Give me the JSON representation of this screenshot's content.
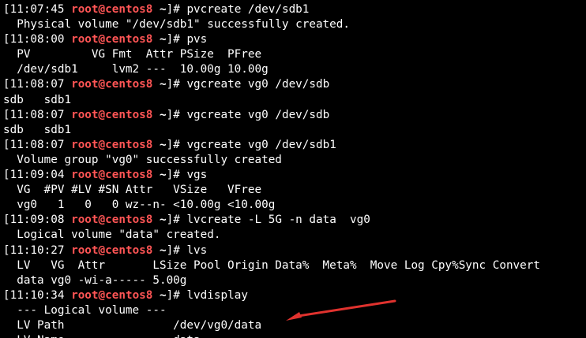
{
  "prompt": {
    "open": "[",
    "at": "@",
    "user": "root",
    "host": "centos8",
    "cwd": "~",
    "close": "]# "
  },
  "colors": {
    "background": "#000000",
    "text": "#ffffff",
    "user": "#ff5555",
    "arrow": "#e0322e"
  },
  "lines": [
    {
      "type": "prompt",
      "time": "11:07:45",
      "cmd": "pvcreate /dev/sdb1"
    },
    {
      "type": "output",
      "text": "  Physical volume \"/dev/sdb1\" successfully created."
    },
    {
      "type": "prompt",
      "time": "11:08:00",
      "cmd": "pvs"
    },
    {
      "type": "output",
      "text": "  PV         VG Fmt  Attr PSize  PFree"
    },
    {
      "type": "output",
      "text": "  /dev/sdb1     lvm2 ---  10.00g 10.00g"
    },
    {
      "type": "prompt",
      "time": "11:08:07",
      "cmd": "vgcreate vg0 /dev/sdb"
    },
    {
      "type": "output",
      "text": "sdb   sdb1"
    },
    {
      "type": "prompt",
      "time": "11:08:07",
      "cmd": "vgcreate vg0 /dev/sdb"
    },
    {
      "type": "output",
      "text": "sdb   sdb1"
    },
    {
      "type": "prompt",
      "time": "11:08:07",
      "cmd": "vgcreate vg0 /dev/sdb1"
    },
    {
      "type": "output",
      "text": "  Volume group \"vg0\" successfully created"
    },
    {
      "type": "prompt",
      "time": "11:09:04",
      "cmd": "vgs"
    },
    {
      "type": "output",
      "text": "  VG  #PV #LV #SN Attr   VSize   VFree"
    },
    {
      "type": "output",
      "text": "  vg0   1   0   0 wz--n- <10.00g <10.00g"
    },
    {
      "type": "prompt",
      "time": "11:09:08",
      "cmd": "lvcreate -L 5G -n data  vg0"
    },
    {
      "type": "output",
      "text": "  Logical volume \"data\" created."
    },
    {
      "type": "prompt",
      "time": "11:10:27",
      "cmd": "lvs"
    },
    {
      "type": "output",
      "text": "  LV   VG  Attr       LSize Pool Origin Data%  Meta%  Move Log Cpy%Sync Convert"
    },
    {
      "type": "output",
      "text": "  data vg0 -wi-a----- 5.00g"
    },
    {
      "type": "prompt",
      "time": "11:10:34",
      "cmd": "lvdisplay"
    },
    {
      "type": "output",
      "text": "  --- Logical volume ---"
    },
    {
      "type": "output",
      "text": "  LV Path                /dev/vg0/data"
    },
    {
      "type": "output",
      "text": "  LV Name                data"
    }
  ]
}
